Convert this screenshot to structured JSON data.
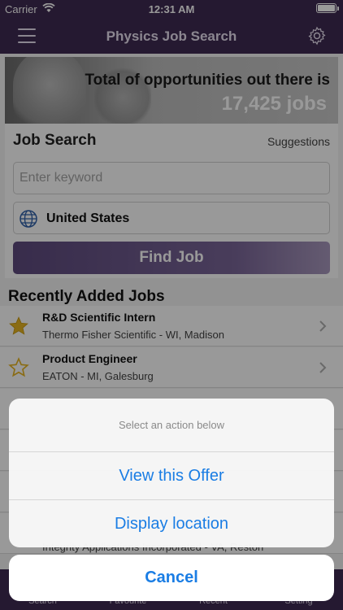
{
  "status_bar": {
    "carrier": "Carrier",
    "time": "12:31 AM"
  },
  "nav": {
    "title": "Physics Job Search",
    "menu_icon": "hamburger-menu-icon",
    "settings_icon": "gear-icon"
  },
  "hero": {
    "title": "Total of opportunities out there is",
    "count": "17,425 jobs"
  },
  "search": {
    "title": "Job Search",
    "suggestions_label": "Suggestions",
    "keyword_placeholder": "Enter keyword",
    "keyword_value": "",
    "location": "United States",
    "find_button_label": "Find Job"
  },
  "recent": {
    "title": "Recently Added Jobs",
    "jobs": [
      {
        "title": "R&D Scientific Intern",
        "company": "Thermo Fisher Scientific - WI, Madison",
        "favorite": true
      },
      {
        "title": "Product Engineer",
        "company": "EATON - MI, Galesburg",
        "favorite": false
      }
    ],
    "partial_company": "Integrity Applications Incorporated - VA, Reston"
  },
  "tabs": [
    {
      "label": "Search"
    },
    {
      "label": "Favourite"
    },
    {
      "label": "Recent"
    },
    {
      "label": "Setting"
    }
  ],
  "action_sheet": {
    "message": "Select an action below",
    "actions": [
      {
        "label": "View this Offer"
      },
      {
        "label": "Display location"
      }
    ],
    "cancel_label": "Cancel"
  },
  "colors": {
    "brand_purple": "#3e2a52",
    "button_purple": "#5e4a7e",
    "action_blue": "#1a7de4",
    "star_gold": "#e6b422"
  }
}
